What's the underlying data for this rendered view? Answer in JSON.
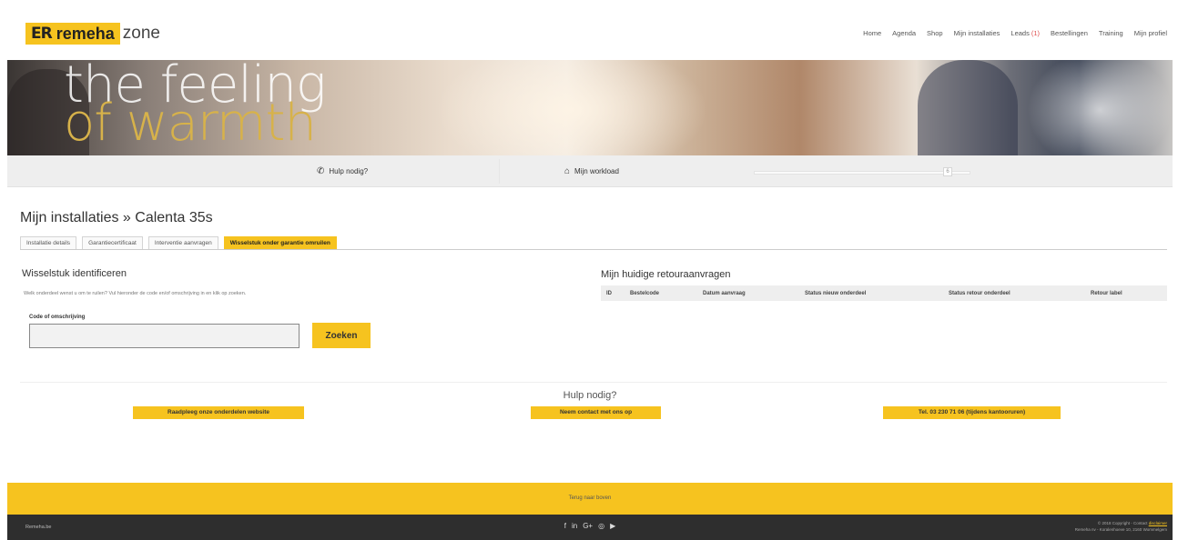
{
  "header": {
    "logo_mark": "ER",
    "logo_brand": "remeha",
    "logo_suffix": "zone",
    "nav": [
      {
        "label": "Home"
      },
      {
        "label": "Agenda"
      },
      {
        "label": "Shop"
      },
      {
        "label": "Mijn installaties"
      },
      {
        "label": "Leads",
        "badge": "(1)"
      },
      {
        "label": "Bestellingen"
      },
      {
        "label": "Training"
      },
      {
        "label": "Mijn profiel"
      }
    ]
  },
  "banner": {
    "line1": "the feeling",
    "line2": "of warmth"
  },
  "quickbar": {
    "help": "Hulp nodig?",
    "workload": "Mijn workload",
    "slider_value": "6"
  },
  "page": {
    "title": "Mijn installaties » Calenta 35s",
    "tabs": [
      {
        "label": "Installatie details",
        "active": false
      },
      {
        "label": "Garantiecertificaat",
        "active": false
      },
      {
        "label": "Interventie aanvragen",
        "active": false
      },
      {
        "label": "Wisselstuk onder garantie omruilen",
        "active": true
      }
    ]
  },
  "identify": {
    "title": "Wisselstuk identificeren",
    "help_text": "Welk onderdeel wenst u om te ruilen? Vul hieronder de code en/of omschrijving in en klik op zoeken.",
    "field_label": "Code of omschrijving",
    "input_value": "",
    "button": "Zoeken"
  },
  "returns": {
    "title": "Mijn huidige retouraanvragen",
    "columns": [
      "ID",
      "Bestelcode",
      "Datum aanvraag",
      "Status nieuw onderdeel",
      "Status retour onderdeel",
      "Retour label"
    ]
  },
  "help": {
    "title": "Hulp nodig?",
    "buttons": [
      "Raadpleeg onze onderdelen website",
      "Neem contact met ons op",
      "Tel. 03 230 71 06 (tijdens kantooruren)"
    ]
  },
  "footer": {
    "back_to_top": "Terug naar boven",
    "left": "Remeha.be",
    "social": [
      "f",
      "in",
      "G+",
      "◎",
      "▶"
    ],
    "copyright": "© 2018 Copyright - Contact",
    "copyright_link": "disclaimer",
    "address": "Remeha nv - Koralenhoeve 10, 2160 Wommelgem"
  },
  "colors": {
    "accent": "#f6c31f",
    "dark_footer": "#2e2e2e",
    "quickbar": "#eeeeee"
  }
}
